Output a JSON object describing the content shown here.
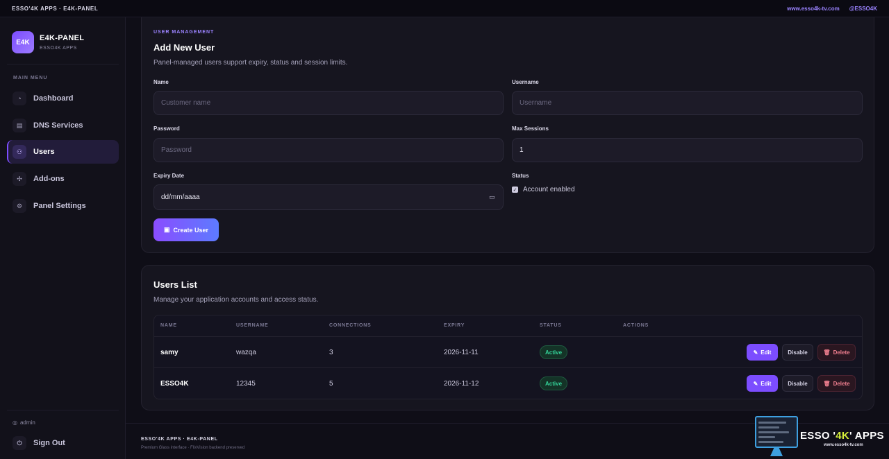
{
  "topbar": {
    "brand": "ESSO'4K APPS · E4K-PANEL",
    "link_site": "www.esso4k-tv.com",
    "link_handle": "@ESSO4K"
  },
  "sidebar": {
    "logo_text": "E4K",
    "title": "E4K-PANEL",
    "subtitle": "ESSO4K APPS",
    "menu_label": "MAIN MENU",
    "items": [
      {
        "label": "Dashboard",
        "icon": "gauge-icon"
      },
      {
        "label": "DNS Services",
        "icon": "server-icon"
      },
      {
        "label": "Users",
        "icon": "users-icon",
        "active": true
      },
      {
        "label": "Add-ons",
        "icon": "puzzle-icon"
      },
      {
        "label": "Panel Settings",
        "icon": "gear-icon"
      }
    ],
    "admin_label": "admin",
    "signout_label": "Sign Out"
  },
  "add_user": {
    "eyebrow": "USER MANAGEMENT",
    "title": "Add New User",
    "subtitle": "Panel-managed users support expiry, status and session limits.",
    "name_label": "Name",
    "name_placeholder": "Customer name",
    "username_label": "Username",
    "username_placeholder": "Username",
    "password_label": "Password",
    "password_placeholder": "Password",
    "max_sessions_label": "Max Sessions",
    "max_sessions_value": "1",
    "expiry_label": "Expiry Date",
    "expiry_value": "dd/mm/aaaa",
    "status_label": "Status",
    "account_enabled_label": "Account enabled",
    "account_enabled": true,
    "submit_label": "Create User"
  },
  "users_list": {
    "title": "Users List",
    "subtitle": "Manage your application accounts and access status.",
    "columns": [
      "NAME",
      "USERNAME",
      "CONNECTIONS",
      "EXPIRY",
      "STATUS",
      "ACTIONS"
    ],
    "rows": [
      {
        "name": "samy",
        "username": "wazqa",
        "connections": "3",
        "expiry": "2026-11-11",
        "status": "Active"
      },
      {
        "name": "ESSO4K",
        "username": "12345",
        "connections": "5",
        "expiry": "2026-11-12",
        "status": "Active"
      }
    ],
    "edit_label": "Edit",
    "disable_label": "Disable",
    "delete_label": "Delete"
  },
  "footer": {
    "line1": "ESSO'4K APPS · E4K-PANEL",
    "line2": "Premium Glass interface · FlixVision backend preserved"
  },
  "watermark": {
    "brand_prefix": "ESSO '",
    "brand_highlight": "4K",
    "brand_suffix": "' APPS",
    "url": "www.esso4k-tv.com"
  },
  "colors": {
    "accent": "#7c4dff",
    "active_status": "#34d399",
    "danger": "#f07f8f",
    "background": "#0f0e17"
  }
}
